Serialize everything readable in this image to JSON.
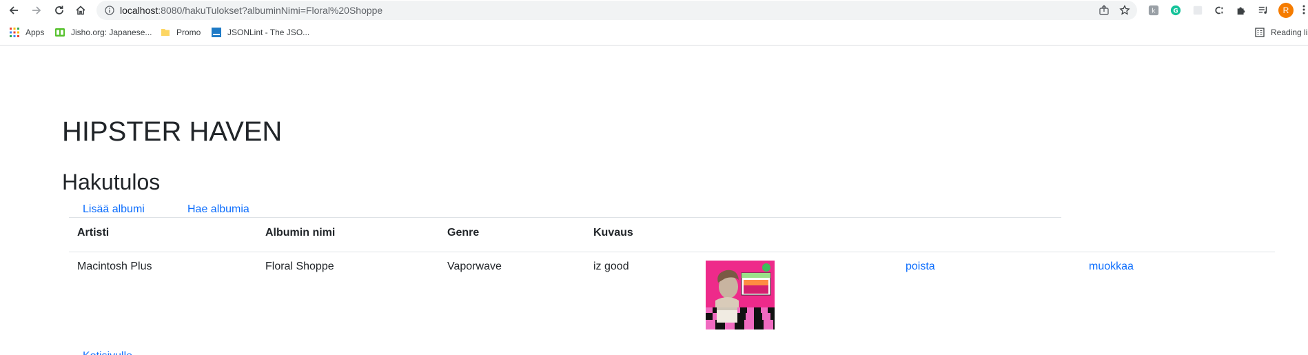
{
  "browser": {
    "url_host": "localhost",
    "url_rest": ":8080/hakuTulokset?albuminNimi=Floral%20Shoppe",
    "profile_initial": "R",
    "bookmarks": [
      {
        "label": "Apps",
        "icon": "apps-grid-icon"
      },
      {
        "label": "Jisho.org: Japanese...",
        "icon": "jisho-icon"
      },
      {
        "label": "Promo",
        "icon": "folder-icon"
      },
      {
        "label": "JSONLint - The JSO...",
        "icon": "jsonlint-icon"
      }
    ],
    "reading_list": "Reading list"
  },
  "page": {
    "site_title": "HIPSTER HAVEN",
    "heading": "Hakutulos",
    "nav": {
      "add_album": "Lisää albumi",
      "search_album": "Hae albumia"
    },
    "table": {
      "headers": [
        "Artisti",
        "Albumin nimi",
        "Genre",
        "Kuvaus"
      ],
      "rows": [
        {
          "artist": "Macintosh Plus",
          "album": "Floral Shoppe",
          "genre": "Vaporwave",
          "description": "iz good",
          "delete_label": "poista",
          "edit_label": "muokkaa"
        }
      ]
    },
    "back_link": "Kotisivulle"
  },
  "colors": {
    "link": "#0d6efd",
    "text": "#212529",
    "profile": "#f57c00"
  }
}
